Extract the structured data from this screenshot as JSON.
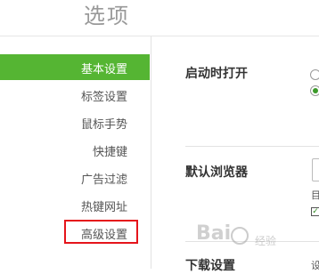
{
  "header": {
    "title": "选项"
  },
  "sidebar": {
    "items": [
      {
        "label": "基本设置",
        "active": true
      },
      {
        "label": "标签设置",
        "active": false
      },
      {
        "label": "鼠标手势",
        "active": false
      },
      {
        "label": "快捷键",
        "active": false
      },
      {
        "label": "广告过滤",
        "active": false
      },
      {
        "label": "热键网址",
        "active": false
      },
      {
        "label": "高级设置",
        "active": false,
        "highlighted": true
      }
    ]
  },
  "main": {
    "sections": [
      {
        "label": "启动时打开"
      },
      {
        "label": "默认浏览器",
        "partial_text": "目",
        "partial_checkbox_text": "✓"
      },
      {
        "label": "下载设置",
        "partial_text": "设"
      }
    ]
  },
  "watermark": {
    "text": "Bai",
    "subtext": "经验"
  },
  "colors": {
    "accent": "#55b533",
    "highlight_border": "#e5141b",
    "radio_checked": "#3c9a2a"
  }
}
